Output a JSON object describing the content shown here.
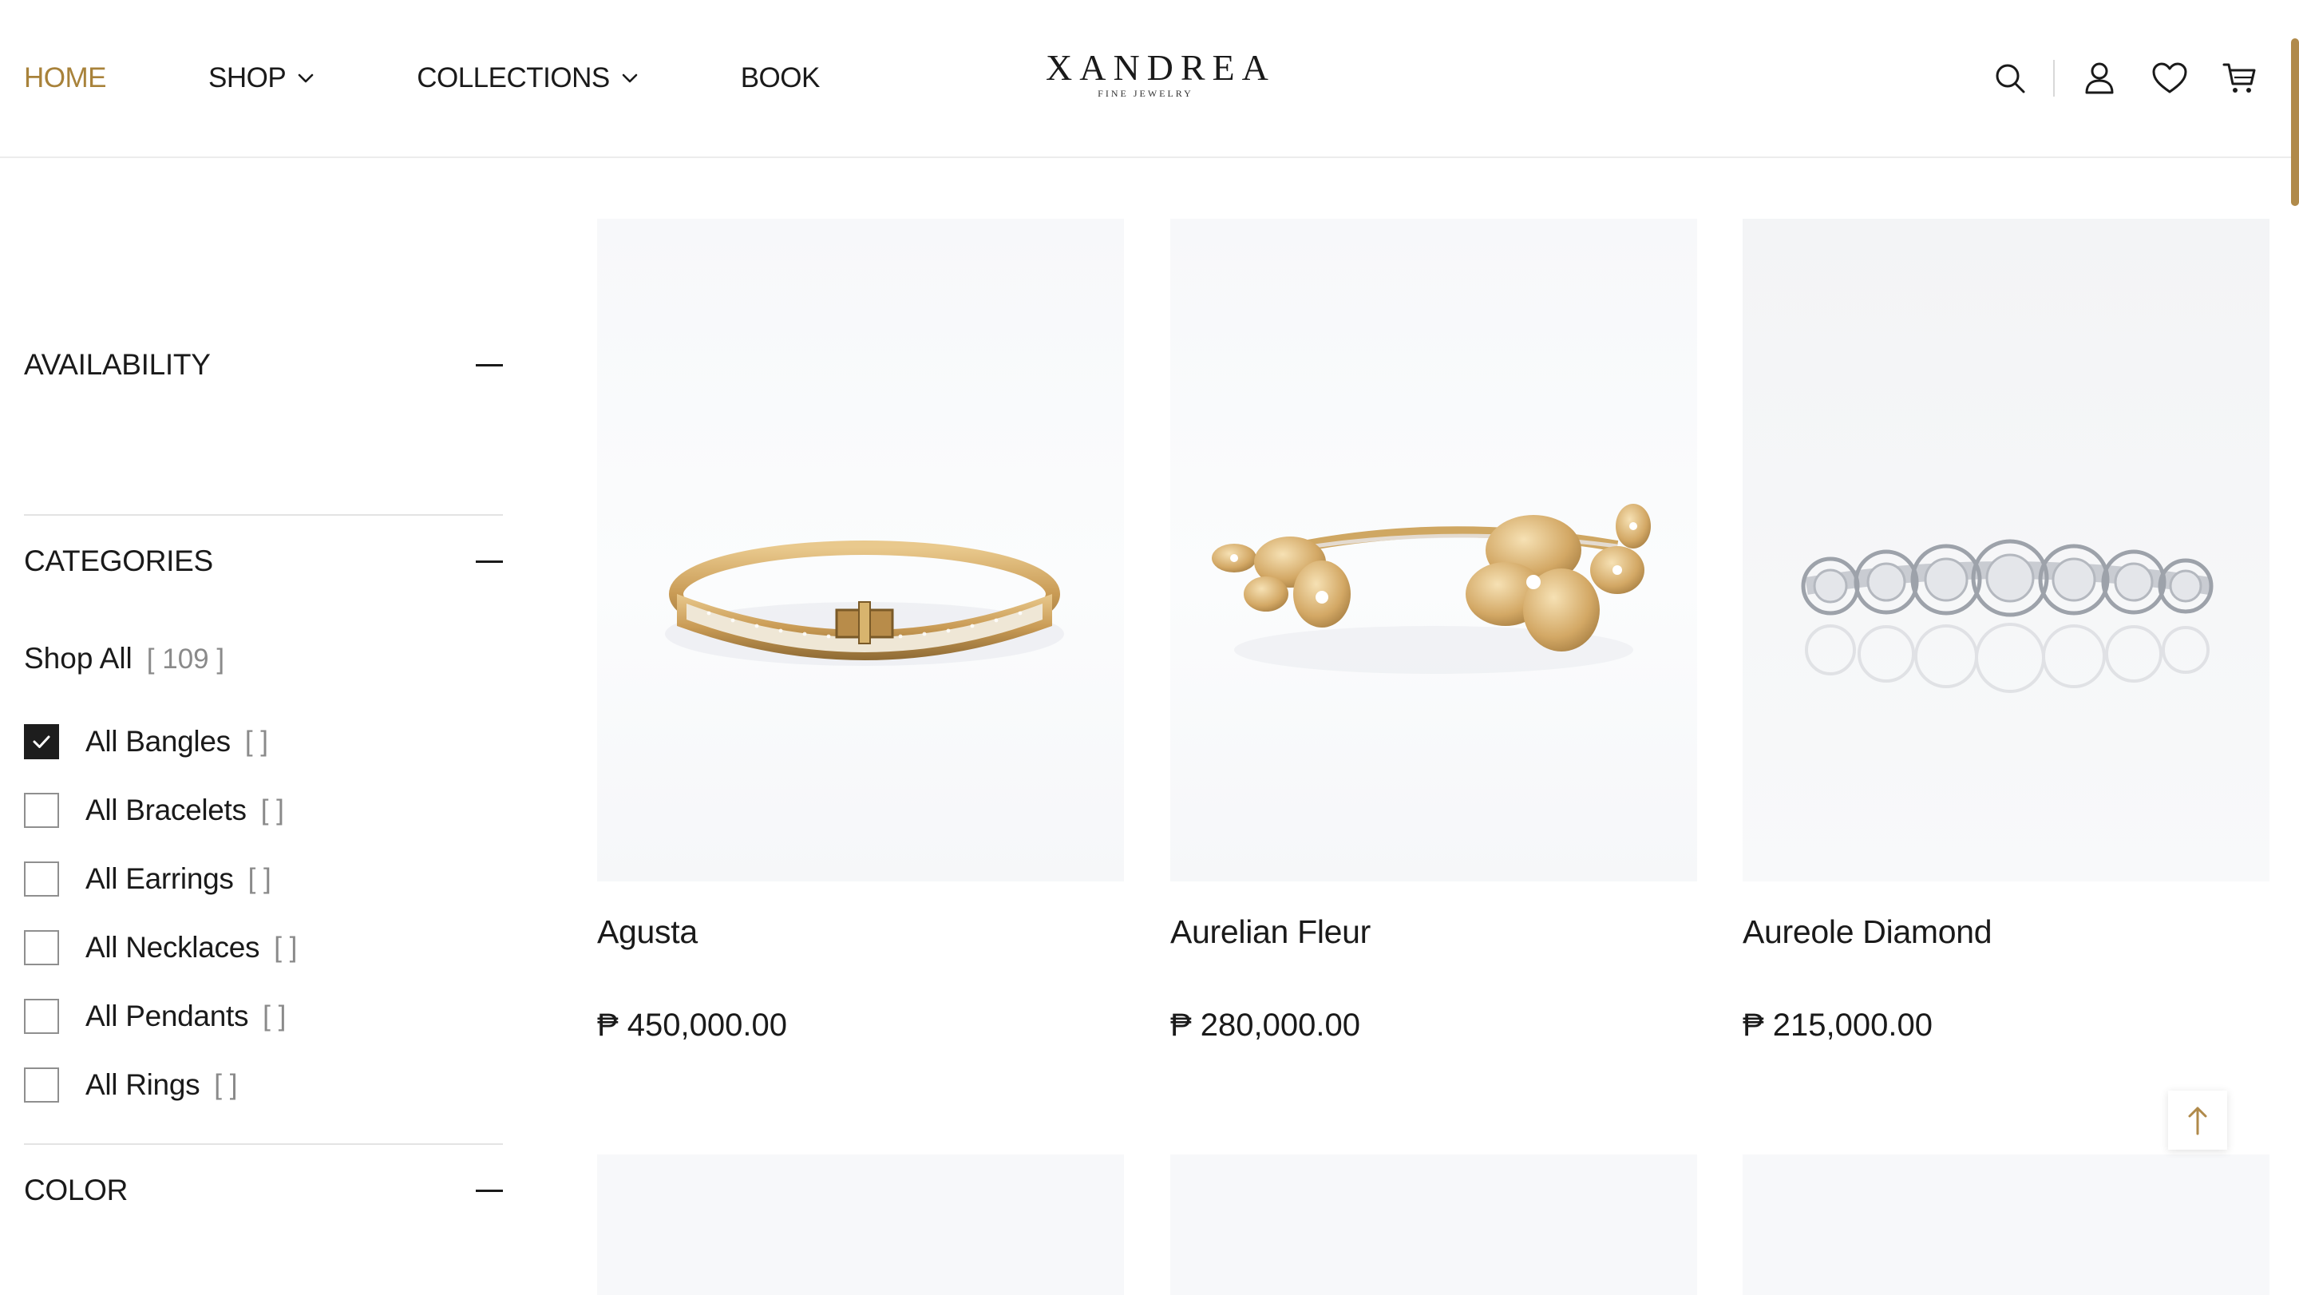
{
  "header": {
    "nav": [
      {
        "label": "HOME",
        "active": true,
        "dropdown": false
      },
      {
        "label": "SHOP",
        "active": false,
        "dropdown": true
      },
      {
        "label": "COLLECTIONS",
        "active": false,
        "dropdown": true
      },
      {
        "label": "BOOK",
        "active": false,
        "dropdown": false
      }
    ],
    "logo": {
      "wordmark": "XANDREA",
      "tagline": "FINE JEWELRY"
    },
    "icons": [
      "search-icon",
      "account-icon",
      "wishlist-heart-icon",
      "cart-icon"
    ]
  },
  "sidebar": {
    "availability": {
      "title": "AVAILABILITY",
      "expanded": true
    },
    "categories": {
      "title": "CATEGORIES",
      "expanded": true,
      "shop_all": {
        "label": "Shop All",
        "count": "[ 109 ]"
      },
      "items": [
        {
          "label": "All Bangles",
          "count": "[ ]",
          "checked": true
        },
        {
          "label": "All Bracelets",
          "count": "[ ]",
          "checked": false
        },
        {
          "label": "All Earrings",
          "count": "[ ]",
          "checked": false
        },
        {
          "label": "All Necklaces",
          "count": "[ ]",
          "checked": false
        },
        {
          "label": "All Pendants",
          "count": "[ ]",
          "checked": false
        },
        {
          "label": "All Rings",
          "count": "[ ]",
          "checked": false
        }
      ]
    },
    "color": {
      "title": "COLOR",
      "expanded": true
    }
  },
  "products": [
    {
      "name": "Agusta",
      "price": "₱ 450,000.00",
      "image": "gold-diamond-pave-bangle"
    },
    {
      "name": "Aurelian Fleur",
      "price": "₱ 280,000.00",
      "image": "gold-flower-cuff-bangle"
    },
    {
      "name": "Aureole Diamond",
      "price": "₱ 215,000.00",
      "image": "white-gold-diamond-halo-bangle"
    }
  ],
  "colors": {
    "accent": "#a8823a",
    "text": "#1a1a1a",
    "muted": "#8a8a8a"
  }
}
